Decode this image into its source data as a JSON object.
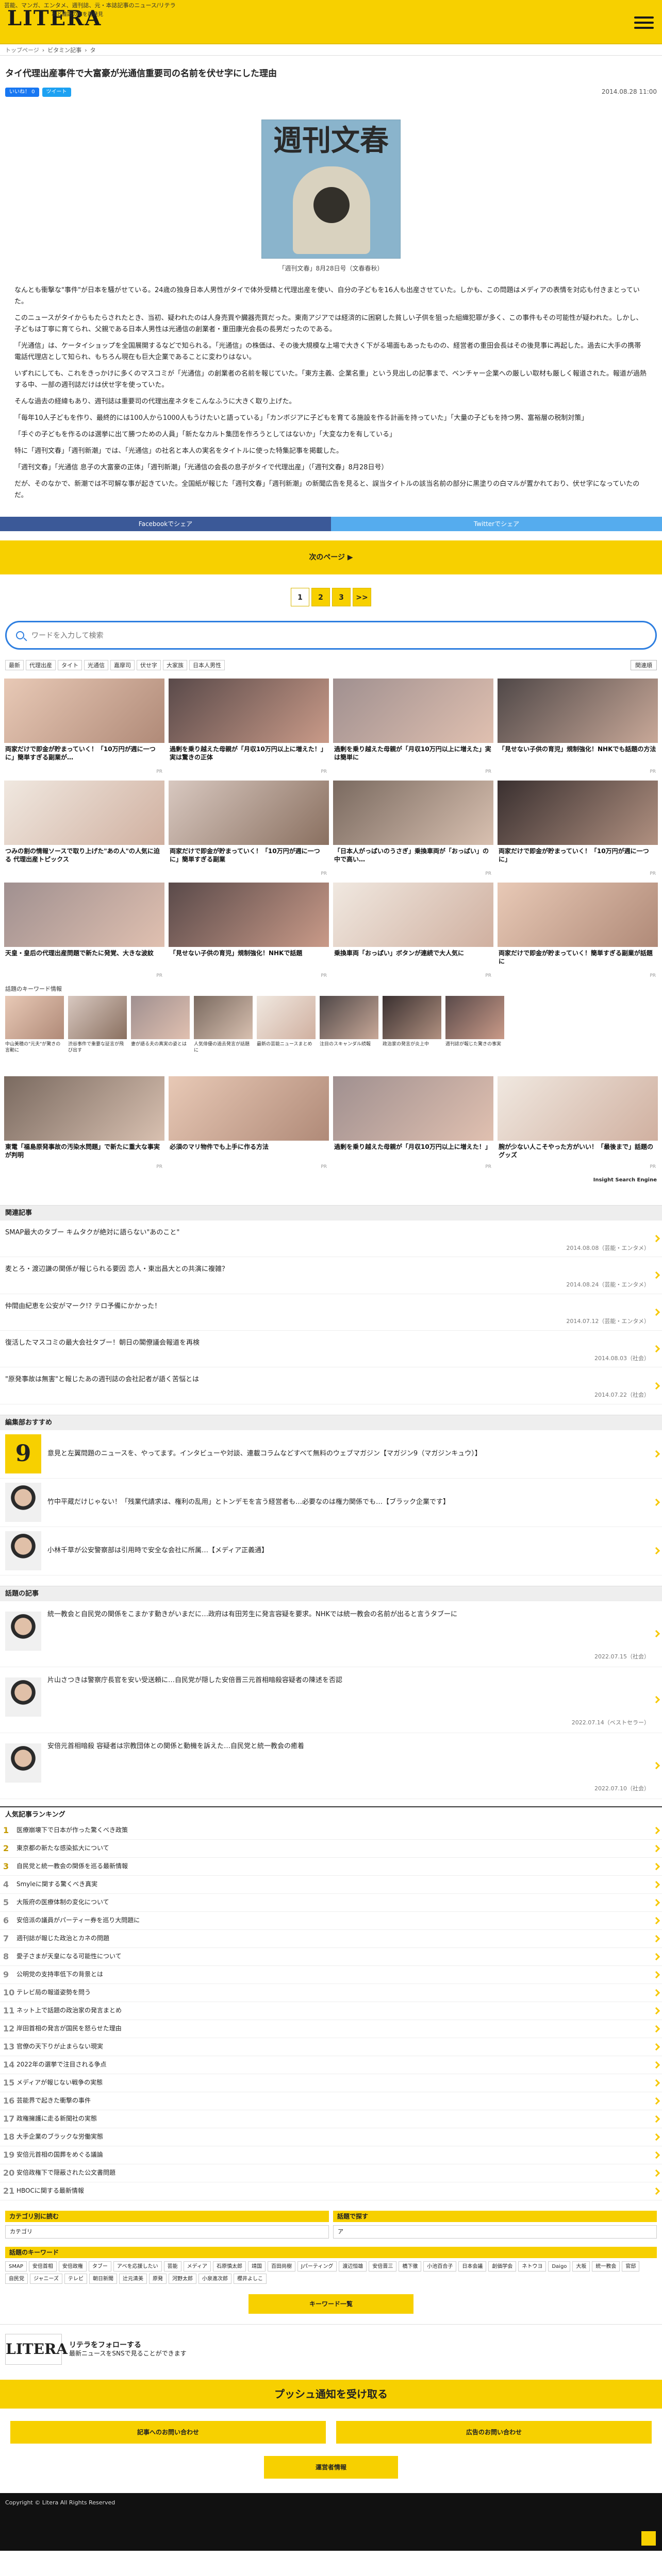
{
  "header": {
    "tagline": "芸能、マンガ、エンタメ、週刊誌、元・本誌記事のニュース/リテラ",
    "logo": "LITERA",
    "logo_sub": "本と雑誌の知を再発見"
  },
  "breadcrumb": [
    "トップページ",
    "ビタミン記事",
    "タ"
  ],
  "article": {
    "title": "タイ代理出産事件で大富豪が光通信重要司の名前を伏せ字にした理由",
    "date": "2014.08.28 11:00",
    "fb_label": "いいね！ 0",
    "tw_label": "ツイート",
    "mag_name": "週刊文春",
    "caption": "「週刊文春」8月28日号（文春春秋）",
    "paragraphs": [
      "なんとも衝撃な\"事件\"が日本を騒がせている。24歳の独身日本人男性がタイで体外受精と代理出産を使い、自分の子どもを16人も出産させていた。しかも、この問題はメディアの表情を対応も付きまとっていた。",
      "このニュースがタイからもたらされたとき、当初、疑われたのは人身売買や臓器売買だった。東南アジアでは経済的に困窮した貧しい子供を狙った組織犯罪が多く、この事件もその可能性が疑われた。しかし、子どもは丁寧に育てられ、父親である日本人男性は光通信の創業者・重田康光会長の長男だったのである。",
      "「光通信」は、ケータイショップを全国展開するなどで知られる。「光通信」の株価は、その後大規模な上場で大きく下がる場面もあったものの、経営者の重田会長はその後見事に再起した。過去に大手の携帯電話代理店として知られ、もちろん現在も巨大企業であることに変わりはない。",
      "いずれにしても、これをきっかけに多くのマスコミが「光通信」の創業者の名前を報じていた。「東方主義、企業名重」という見出しの記事まで、ベンチャー企業への厳しい取材も厳しく報道された。報道が過熱する中、一部の週刊誌だけは伏せ字を使っていた。",
      "そんな過去の経緯もあり、週刊誌は重要司の代理出産ネタをこんなふうに大きく取り上げた。",
      "「毎年10人子どもを作り、最終的には100人から1000人もうけたいと語っている」「カンボジアに子どもを育てる施設を作る計画を持っていた」「大量の子どもを持つ男、富裕層の税制対策」",
      "「手ぐの子どもを作るのは選挙に出て勝つための人員」「新たなカルト集団を作ろうとしてはないか」「大変な力を有している」",
      "特に「週刊文春」「週刊新潮」では、「光通信」の社名と本人の実名をタイトルに使った特集記事を掲載した。",
      "「週刊文春」「光通信 息子の大富豪の正体」「週刊新潮」「光通信の会長の息子がタイで代理出産」（「週刊文春」8月28日号）",
      "だが、そのなかで、新潮では不可解な事が起きていた。全国紙が報じた「週刊文春」「週刊新潮」の新聞広告を見ると、誤当タイトルの該当名前の部分に黒塗りの白マルが置かれており、伏せ字になっていたのだ。"
    ]
  },
  "share": {
    "facebook": "Facebookでシェア",
    "twitter": "Twitterでシェア"
  },
  "next_label": "次のページ ▶",
  "pager": [
    "1",
    "2",
    "3",
    ">>"
  ],
  "search": {
    "placeholder": "ワードを入力して検索"
  },
  "tags": [
    "最新",
    "代理出産",
    "タイト",
    "光通信",
    "嘉摩司",
    "伏せ字",
    "大家族",
    "日本人男性"
  ],
  "sort_label": "関連順",
  "cards": [
    {
      "title": "両家だけで即金が貯まっていく！「10万円が週に一つに」簡単すぎる副業が…",
      "src": "PR"
    },
    {
      "title": "過剰を乗り越えた母親が「月収10万円以上に増えた！」実は驚きの正体",
      "src": "PR"
    },
    {
      "title": "過剰を乗り越えた母親が「月収10万円以上に増えた」実は簡単に",
      "src": "PR"
    },
    {
      "title": "「見せない子供の育児」規制強化！NHKでも話題の方法",
      "src": "PR"
    },
    {
      "title": "つみの割の情報ソースで取り上げた\"あの人\"の人気に迫る 代理出産トピックス",
      "src": ""
    },
    {
      "title": "両家だけで即金が貯まっていく！「10万円が週に一つに」簡単すぎる副業",
      "src": "PR"
    },
    {
      "title": "「日本人がっぱいのうさぎ」乗換車両が「おっぱい」の中で高い…",
      "src": "PR"
    },
    {
      "title": "両家だけで即金が貯まっていく！「10万円が週に一つに」",
      "src": "PR"
    },
    {
      "title": "天皇・皇后の代理出産問題で新たに発覚、大きな波紋",
      "src": "PR"
    },
    {
      "title": "「見せない子供の育児」規制強化！NHKで話題",
      "src": "PR"
    },
    {
      "title": "乗換車両「おっぱい」ボタンが連続で大人気に",
      "src": "PR"
    },
    {
      "title": "両家だけで即金が貯まっていく！簡単すぎる副業が話題に",
      "src": "PR"
    }
  ],
  "recommend": {
    "heading": "話題のキーワード情報",
    "items": [
      "中山美穂の\"元夫\"が驚きの言動に",
      "渋谷事件で重要な証言が飛び出す",
      "妻が語る夫の真実の姿とは",
      "人気俳優の過去発言が話題に",
      "最新の芸能ニュースまとめ",
      "注目のスキャンダル続報",
      "政治家の発言が炎上中",
      "週刊誌が報じた驚きの事実"
    ]
  },
  "ads": [
    {
      "title": "東電「福島原発事故の汚染水問題」で新たに重大な事実が判明",
      "src": "PR"
    },
    {
      "title": "必須のマリ物件でも上手に作る方法",
      "src": "PR"
    },
    {
      "title": "過剰を乗り越えた母親が「月収10万円以上に増えた！」",
      "src": "PR"
    },
    {
      "title": "腕が少ない人こそやった方がいい！「最後まで」話題のグッズ",
      "src": "PR"
    }
  ],
  "insight": "Insight Search Engine",
  "related": {
    "heading": "関連記事",
    "items": [
      {
        "title": "SMAP最大のタブー キムタクが絶対に語らない\"あのこと\"",
        "date": "2014.08.08（芸能・エンタメ）"
      },
      {
        "title": "麦とろ・渡辺謙の関係が報じられる要因 恋人・東出昌大との共演に複雑？",
        "date": "2014.08.24（芸能・エンタメ）"
      },
      {
        "title": "仲間由紀恵を公安がマーク!? テロ予備にかかった！",
        "date": "2014.07.12（芸能・エンタメ）"
      },
      {
        "title": "復活したマスコミの最大会社タブー！朝日の閣僚議会報道を再検",
        "date": "2014.08.03（社会）"
      },
      {
        "title": "\"原発事故は無害\"と報じたあの週刊誌の会社記者が語く苦悩とは",
        "date": "2014.07.22（社会）"
      }
    ]
  },
  "recommend2": {
    "heading": "編集部おすすめ",
    "items": [
      {
        "title": "意見と左翼問題のニュースを、やってます。インタビューや対談、連載コラムなどすべて無料のウェブマガジン【マガジン9（マガジンキュウ）】",
        "icon": "9"
      },
      {
        "title": "竹中平蔵だけじゃない！「残業代請求は、権利の乱用」とトンデモを言う経営者も…必要なのは権力関係でも…【ブラック企業です】",
        "icon": ""
      },
      {
        "title": "小林千草が公安警察部は引用時で安全な会社に所属…【メディア正義通】",
        "icon": ""
      }
    ]
  },
  "topics": {
    "heading": "話題の記事",
    "items": [
      {
        "title": "統一教会と自民党の関係をこまかす動きがいまだに…政府は有田芳生に発言容疑を要求。NHKでは統一教会の名前が出ると言うタブーに",
        "date": "2022.07.15（社会）"
      },
      {
        "title": "片山さつきは警察庁長官を安い受送頼に…自民党が隠した安倍晋三元首相暗殺容疑者の陳述を否認",
        "date": "2022.07.14（ベストセラー）"
      },
      {
        "title": "安倍元首相暗殺 容疑者は宗教団体との関係と動機を訴えた…自民党と統一教会の癒着",
        "date": "2022.07.10（社会）"
      }
    ]
  },
  "ranking": {
    "heading": "人気記事ランキング",
    "items": [
      "医療崩壊下で日本が作った驚くべき政策",
      "東京都の新たな感染拡大について",
      "自民党と統一教会の関係を巡る最新情報",
      "Smyleに関する驚くべき真実",
      "大阪府の医療体制の変化について",
      "安倍派の議員がパーティー券を巡り大問題に",
      "週刊誌が報じた政治とカネの問題",
      "愛子さまが天皇になる可能性について",
      "公明党の支持率低下の背景とは",
      "テレビ局の報道姿勢を問う",
      "ネット上で話題の政治家の発言まとめ",
      "岸田首相の発言が国民を怒らせた理由",
      "官僚の天下りが止まらない現実",
      "2022年の選挙で注目される争点",
      "メディアが報じない戦争の実態",
      "芸能界で起きた衝撃の事件",
      "政権擁護に走る新聞社の実態",
      "大手企業のブラックな労働実態",
      "安倍元首相の国葬をめぐる議論",
      "安倍政権下で隠蔽された公文書問題",
      "HBOCに関する最新情報"
    ]
  },
  "category": {
    "heading1": "カテゴリ別に読む",
    "heading2": "話題で探す",
    "select1": "カテゴリ",
    "select2": "ア"
  },
  "keywords": {
    "heading": "話題のキーワード",
    "items": [
      "SMAP",
      "安倍首相",
      "安倍政権",
      "タブー",
      "アベを応援したい",
      "芸能",
      "メディア",
      "石原慎太郎",
      "靖国",
      "百田尚樹",
      "Jパーティング",
      "渡辺恒雄",
      "安倍晋三",
      "橋下徹",
      "小池百合子",
      "日本会議",
      "創価学会",
      "ネトウヨ",
      "Daigo",
      "大坂",
      "統一教会",
      "官邸",
      "自民党",
      "ジャニーズ",
      "テレビ",
      "朝日新聞",
      "辻元清美",
      "原発",
      "河野太郎",
      "小泉進次郎",
      "櫻井よしこ"
    ],
    "more": "キーワード一覧"
  },
  "follow": {
    "logo": "LITERA",
    "title": "リテラをフォローする",
    "sub": "最新ニュースをSNSで見ることができます"
  },
  "push_label": "プッシュ通知を受け取る",
  "links": {
    "contact": "記事へのお問い合わせ",
    "ad": "広告のお問い合わせ",
    "company": "運営者情報"
  },
  "footer": "Copyright © Litera All Rights Reserved"
}
